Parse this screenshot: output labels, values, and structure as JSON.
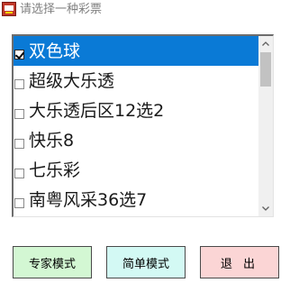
{
  "window": {
    "title": "请选择一种彩票",
    "icon": "lottery-app-icon"
  },
  "lottery_list": {
    "items": [
      {
        "label": "双色球",
        "checked": true,
        "selected": true
      },
      {
        "label": "超级大乐透",
        "checked": false,
        "selected": false
      },
      {
        "label": "大乐透后区12选2",
        "checked": false,
        "selected": false
      },
      {
        "label": "快乐8",
        "checked": false,
        "selected": false
      },
      {
        "label": "七乐彩",
        "checked": false,
        "selected": false
      },
      {
        "label": "南粤风采36选7",
        "checked": false,
        "selected": false
      }
    ]
  },
  "buttons": {
    "expert_label": "专家模式",
    "simple_label": "简单模式",
    "exit_label": "退 出"
  },
  "colors": {
    "selection": "#0a7ad6",
    "expert_button": "#d3f7d3",
    "simple_button": "#d3f9f4",
    "exit_button": "#fbd5d5"
  }
}
